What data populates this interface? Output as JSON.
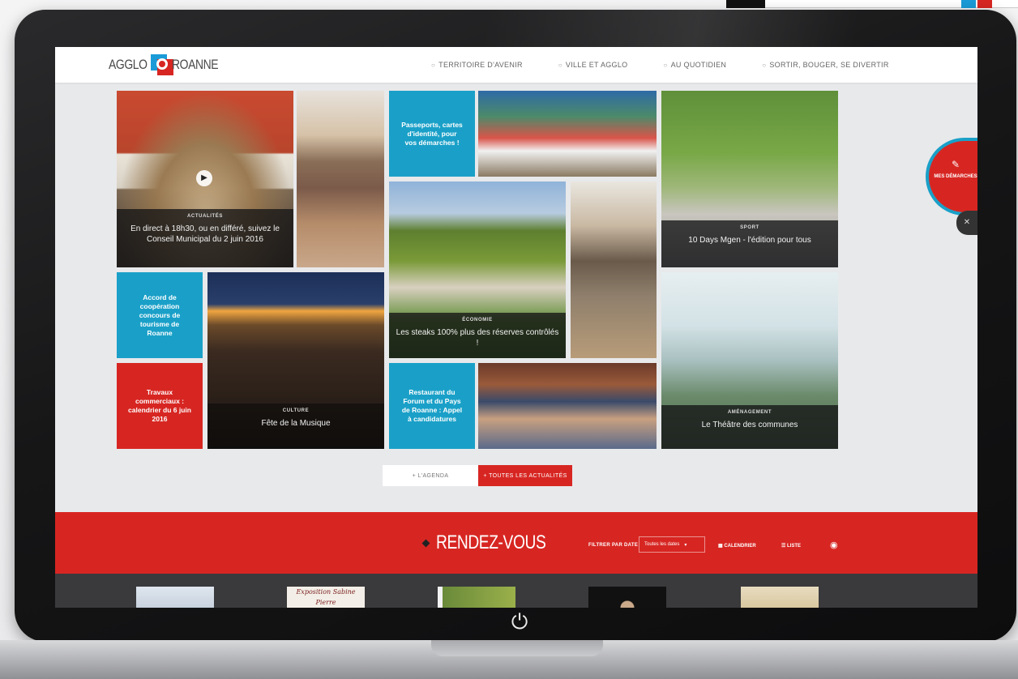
{
  "colors": {
    "brand_red": "#d72622",
    "brand_blue": "#1aa0c8",
    "caption_bg": "#141416",
    "page_bg": "#e8e9eb"
  },
  "header": {
    "logo_left": "AGGLO",
    "logo_right": "ROANNE",
    "logo_icon": "agglo-roanne-logo",
    "nav": [
      {
        "icon": "circle-icon",
        "label": "TERRITOIRE D'AVENIR"
      },
      {
        "icon": "circle-icon",
        "label": "VILLE ET AGGLO"
      },
      {
        "icon": "circle-icon",
        "label": "AU QUOTIDIEN"
      },
      {
        "icon": "circle-icon",
        "label": "SORTIR, BOUGER, SE DIVERTIR"
      }
    ]
  },
  "tiles": {
    "council": {
      "category": "ACTUALITÉS",
      "title": "En direct à 18h30, ou en différé, suivez le Conseil Municipal du 2 juin 2016"
    },
    "passports": {
      "text": "Passeports, cartes d'identité, pour vos démarches !"
    },
    "sport": {
      "category": "SPORT",
      "title": "10 Days Mgen - l'édition pour tous"
    },
    "meat": {
      "category": "ÉCONOMIE",
      "title": "Les steaks 100% plus des réserves contrôlés !"
    },
    "cooperation": {
      "text": "Accord de coopération concours de tourisme de Roanne"
    },
    "commerce": {
      "text": "Travaux commerciaux : calendrier du 6 juin 2016"
    },
    "music": {
      "category": "CULTURE",
      "title": "Fête de la Musique"
    },
    "restaurant": {
      "text": "Restaurant du Forum et du Pays de Roanne : Appel à candidatures"
    },
    "theatre": {
      "category": "AMÉNAGEMENT",
      "title": "Le Théâtre des communes"
    }
  },
  "buttons": {
    "left": "+ L'AGENDA",
    "right": "+ TOUTES LES ACTUALITÉS"
  },
  "floating": {
    "label": "MES DÉMARCHES",
    "icon": "pencil-icon",
    "close_icon": "close-icon"
  },
  "rendezvous": {
    "title": "RENDEZ-VOUS",
    "filter_label": "FILTRER PAR DATE",
    "select_value": "Toutes les dates",
    "calendar_label": "CALENDRIER",
    "list_label": "LISTE",
    "rss_icon": "rss-icon"
  },
  "thumbs": {
    "second": "Exposition Sabine Pierre"
  },
  "power_icon": "power-icon"
}
